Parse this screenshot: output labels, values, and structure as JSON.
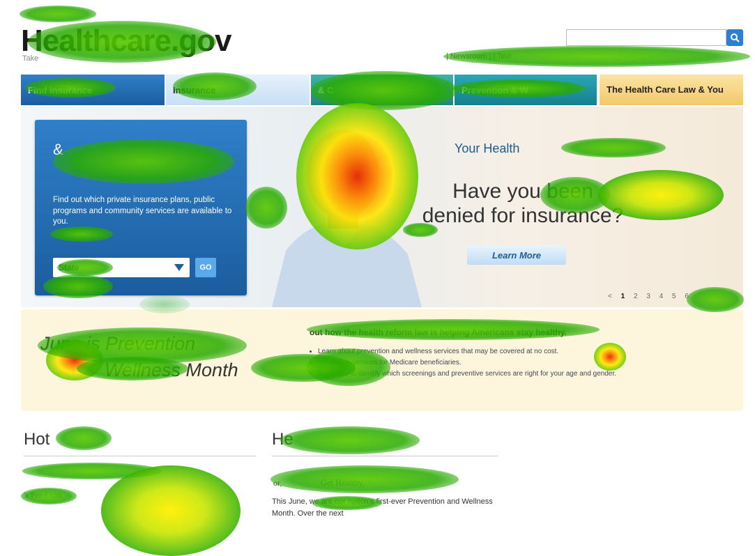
{
  "header": {
    "logo_text": "Healthcare.gov",
    "tagline": "Take",
    "util_links": "| Newsroom | | Text",
    "search": {
      "placeholder": "",
      "icon": "search-icon"
    }
  },
  "nav": {
    "tabs": [
      {
        "label": "Find Insurance"
      },
      {
        "label": "Insurance"
      },
      {
        "label": "& C"
      },
      {
        "label": "Prevention & W"
      },
      {
        "label": "The Health Care Law & You"
      }
    ]
  },
  "hero": {
    "box_title": "& ",
    "box_description": "Find out which private insurance plans, public programs and community services are available to you.",
    "state_select": "State",
    "go_label": "GO",
    "kicker": "Your Health",
    "headline": "Have you been denied for insurance?",
    "learn_more": "Learn More",
    "pager": [
      "<",
      "1",
      "2",
      "3",
      "4",
      "5",
      "6"
    ]
  },
  "banner": {
    "title_line1": "June is Prevention",
    "title_line2": "Wellness Month",
    "headline": "out how the health reform law is helping Americans stay healthy.",
    "list": [
      "Learn about prevention and wellness services that may be covered at no cost.",
      "preventive services for Medicare beneficiaries.",
      "ender.gov to identify which screenings and preventive services are right for your age and gender."
    ]
  },
  "hot_topics": {
    "title": "Hot",
    "item": "'s Pre-Exist"
  },
  "blog": {
    "title": "He",
    "sub": "or,",
    "link": "Get Healthy,",
    "body": "This June, we are our nation's first-ever Prevention and Wellness Month. Over the next"
  },
  "colors": {
    "nav_blue": "#2f7fc9",
    "teal": "#3fb3a9",
    "gold": "#f3c86a",
    "banner": "#fdf6dc"
  }
}
